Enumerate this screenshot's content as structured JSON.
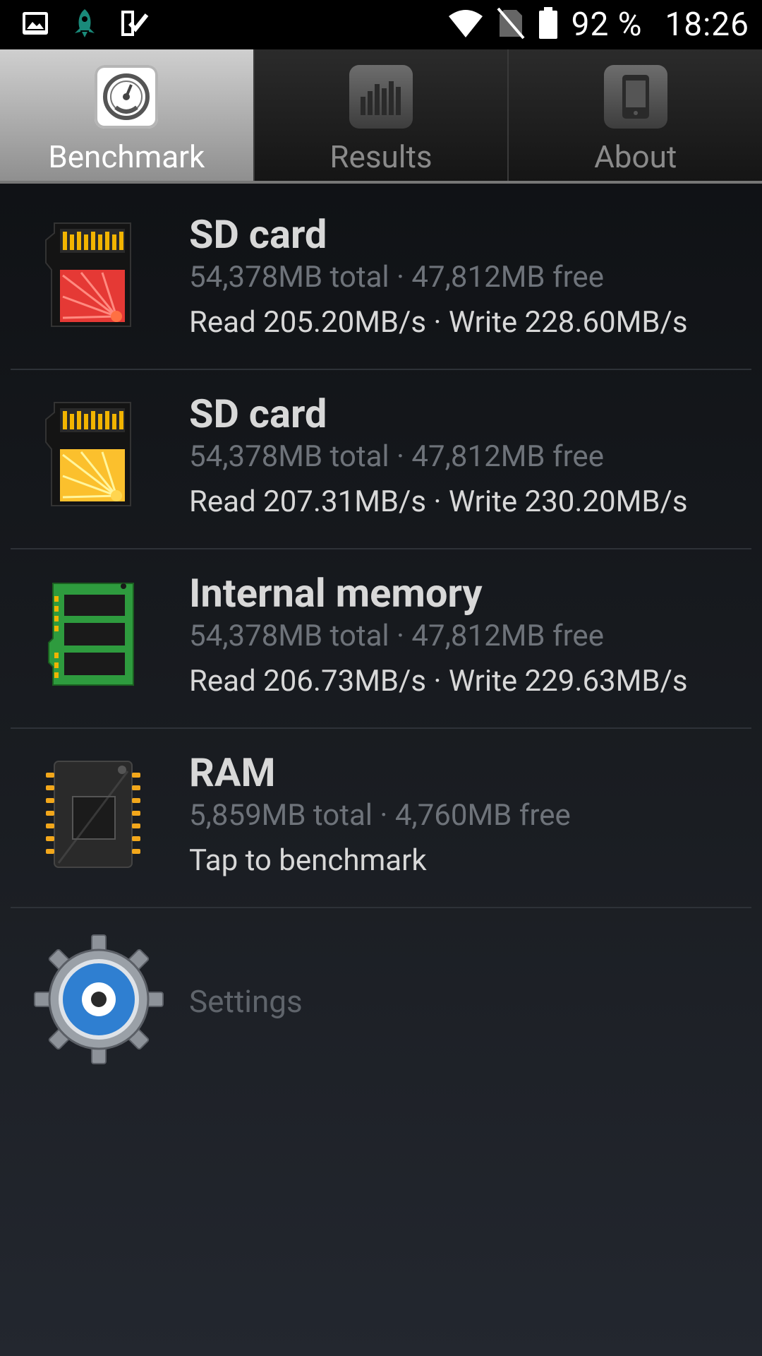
{
  "status_bar": {
    "battery_percent": "92 %",
    "time": "18:26",
    "left_icons": [
      "gallery-icon",
      "rocket-icon",
      "checklist-icon"
    ],
    "right_icons": [
      "wifi-icon",
      "no-sim-icon",
      "battery-icon"
    ]
  },
  "tabs": [
    {
      "label": "Benchmark",
      "icon": "speedometer-icon",
      "active": true
    },
    {
      "label": "Results",
      "icon": "bar-chart-icon",
      "active": false
    },
    {
      "label": "About",
      "icon": "phone-icon",
      "active": false
    }
  ],
  "storage_items": [
    {
      "title": "SD card",
      "sub1": "54,378MB total · 47,812MB free",
      "sub2": "Read 205.20MB/s · Write 228.60MB/s",
      "icon": "sd-card-red-icon",
      "accent": "#e53935"
    },
    {
      "title": "SD card",
      "sub1": "54,378MB total · 47,812MB free",
      "sub2": "Read 207.31MB/s · Write 230.20MB/s",
      "icon": "sd-card-yellow-icon",
      "accent": "#fbc02d"
    },
    {
      "title": "Internal memory",
      "sub1": "54,378MB total · 47,812MB free",
      "sub2": "Read 206.73MB/s · Write 229.63MB/s",
      "icon": "memory-module-icon",
      "accent": "#2e9b3e"
    },
    {
      "title": "RAM",
      "sub1": "5,859MB total · 4,760MB free",
      "sub2": "Tap to benchmark",
      "icon": "ram-chip-icon",
      "accent": "#f2a71b"
    }
  ],
  "settings": {
    "label": "Settings",
    "icon": "settings-gear-icon"
  }
}
